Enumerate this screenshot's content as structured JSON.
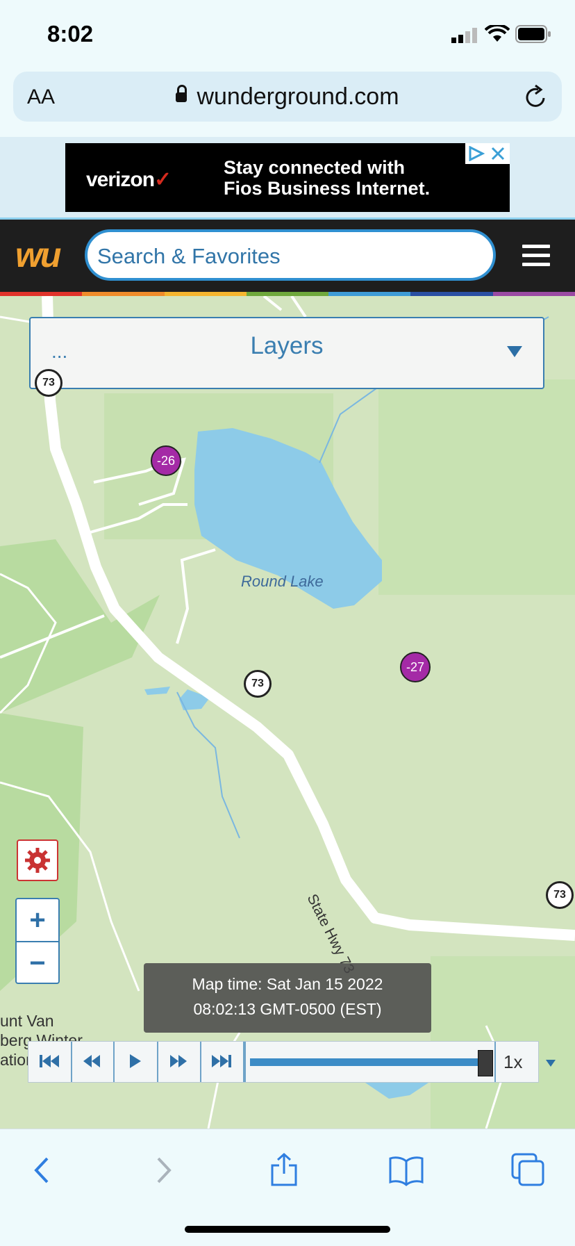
{
  "status_bar": {
    "time": "8:02"
  },
  "browser": {
    "text_size": "AA",
    "url": "wunderground.com"
  },
  "ad": {
    "brand": "verizon",
    "brand_mark": "✓",
    "headline_line1": "Stay connected with",
    "headline_line2": "Fios Business Internet."
  },
  "header": {
    "logo": "wu",
    "search_placeholder": "Search & Favorites"
  },
  "rainbow_colors": [
    "#e1332b",
    "#f08c2b",
    "#f5b52f",
    "#6fa83c",
    "#3e9bd6",
    "#2a4fa3",
    "#9b4aa3"
  ],
  "layers": {
    "dots": "...",
    "label": "Layers"
  },
  "map": {
    "route_shields": [
      "73",
      "73",
      "73"
    ],
    "stations": [
      "-26",
      "-27"
    ],
    "lake_label": "Round Lake",
    "road_label": "State Hwy 73",
    "place_line1": "unt Van",
    "place_line2": "berg Winter",
    "place_line3": "ation"
  },
  "zoom": {
    "plus": "+",
    "minus": "−"
  },
  "map_time": {
    "line1": "Map time: Sat Jan 15 2022",
    "line2": "08:02:13 GMT-0500 (EST)"
  },
  "player": {
    "speed": "1x"
  },
  "colors": {
    "accent": "#3a7eb0",
    "station": "#a42aa6",
    "water": "#8dcbe8",
    "land": "#d3e4bf"
  }
}
